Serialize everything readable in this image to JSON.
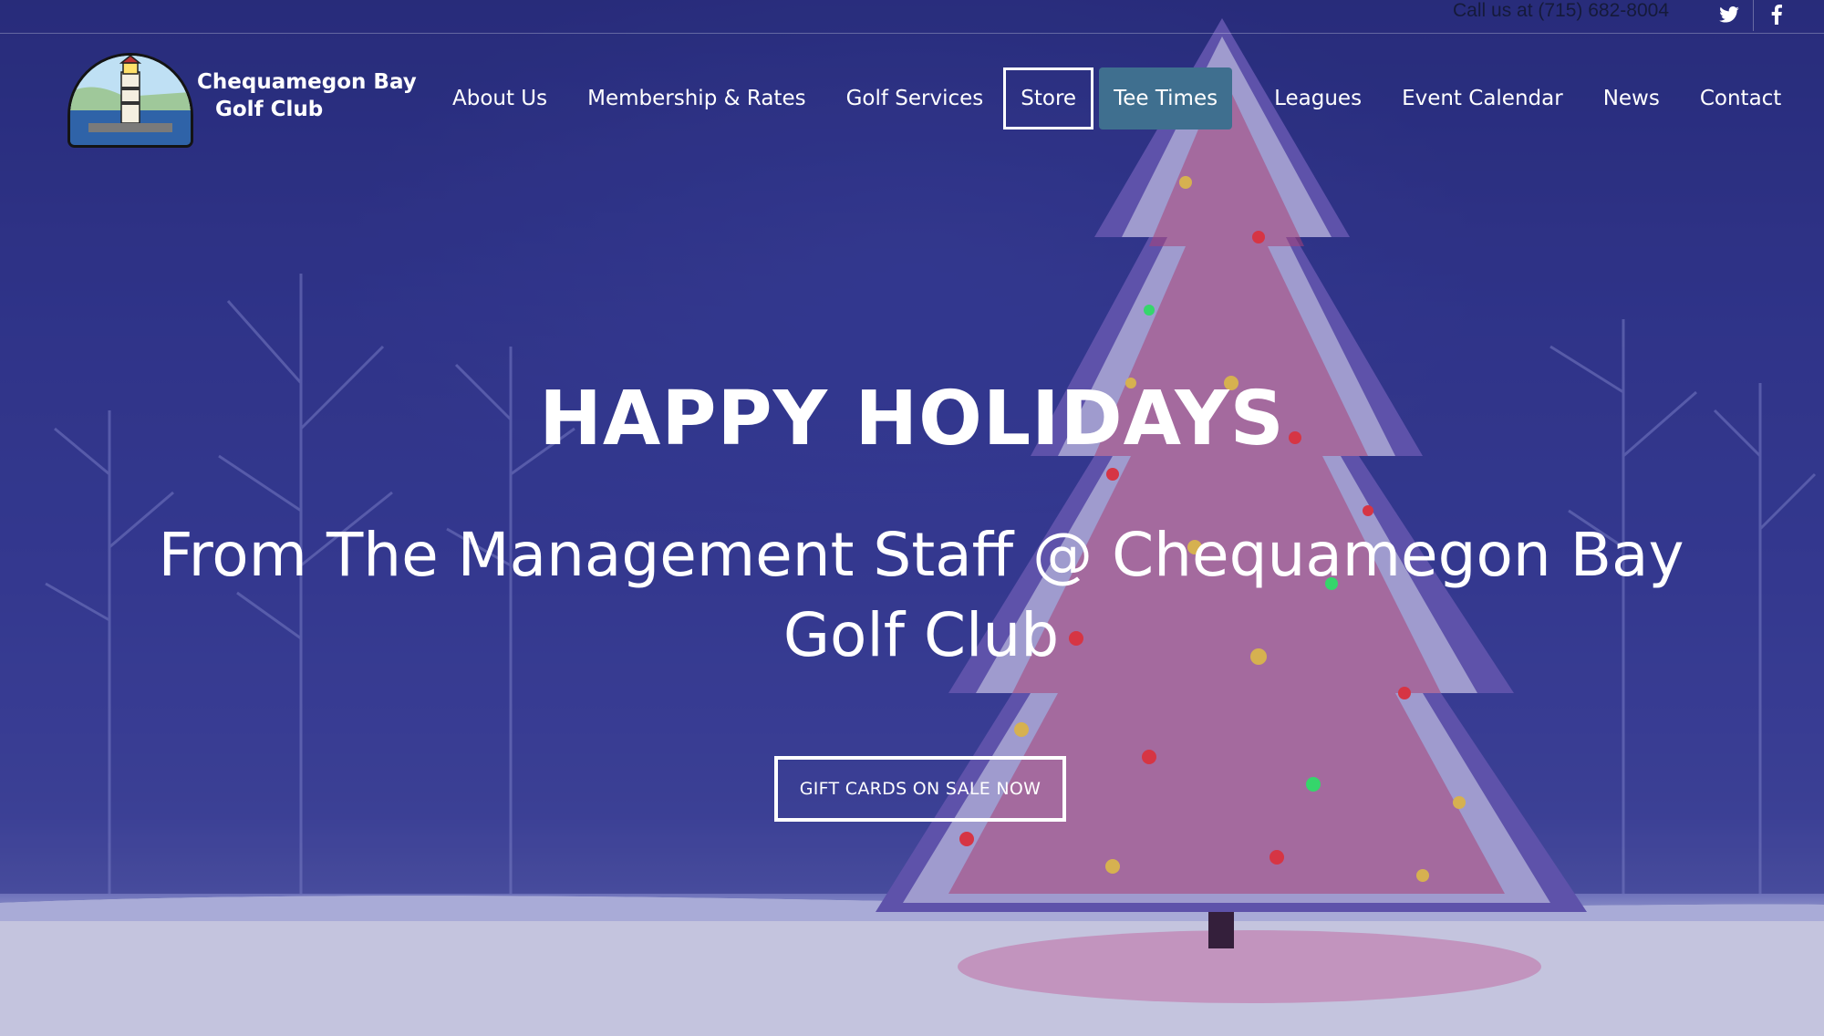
{
  "topbar": {
    "phone": "Call us at (715) 682-8004",
    "twitter_icon": "twitter-icon",
    "facebook_icon": "facebook-icon"
  },
  "logo": {
    "line1": "Chequamegon Bay",
    "line2": "Golf Club",
    "icon": "lighthouse-logo"
  },
  "nav": {
    "items": [
      {
        "label": "About Us"
      },
      {
        "label": "Membership & Rates"
      },
      {
        "label": "Golf Services"
      },
      {
        "label": "Store"
      },
      {
        "label": "Tee Times"
      },
      {
        "label": "Leagues"
      },
      {
        "label": "Event Calendar"
      },
      {
        "label": "News"
      },
      {
        "label": "Contact"
      }
    ]
  },
  "hero": {
    "title": "HAPPY HOLIDAYS",
    "subtitle": "From The Management Staff @ Chequamegon Bay Golf Club",
    "cta_label": "GIFT CARDS ON SALE NOW"
  },
  "colors": {
    "tee_times_bg": "#3f6f8f",
    "hero_overlay": "#2a3078"
  }
}
